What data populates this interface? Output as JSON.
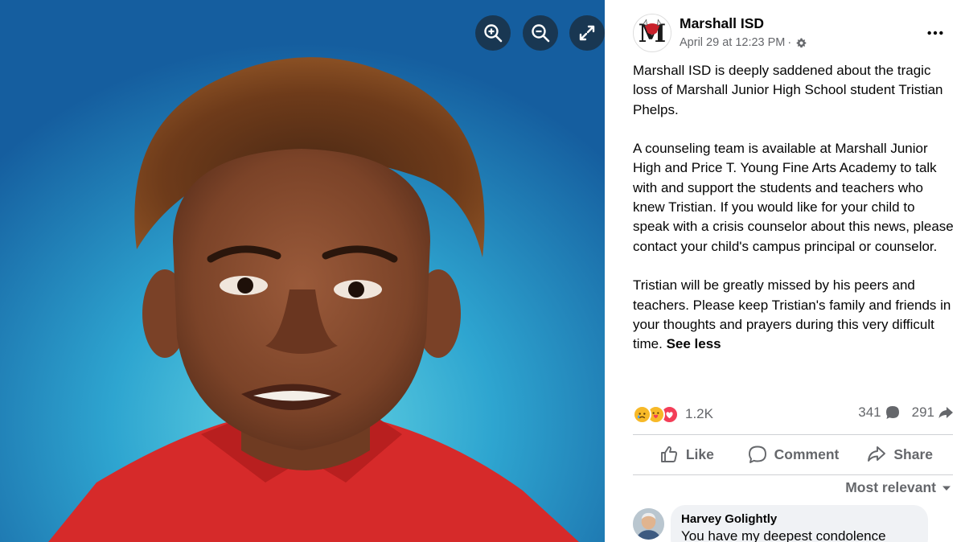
{
  "viewer": {
    "zoom_in_icon": "zoom-in-icon",
    "zoom_out_icon": "zoom-out-icon",
    "fullscreen_icon": "expand-icon"
  },
  "post": {
    "page_name": "Marshall ISD",
    "timestamp": "April 29 at 12:23 PM",
    "meta_separator": "·",
    "privacy_icon": "gear-icon",
    "paragraphs": [
      "Marshall ISD is deeply saddened about the tragic loss of Marshall Junior High School student Tristian Phelps.",
      "A counseling team is available at Marshall Junior High and Price T. Young Fine Arts Academy to talk with and support the students and teachers who knew Tristian. If you would like for your child to speak with a crisis counselor about this news, please contact your child's campus principal or counselor.",
      "Tristian will be greatly missed by his peers and teachers. Please keep Tristian's family and friends in your thoughts and prayers during this very difficult time."
    ],
    "see_less": "See less",
    "reactions": {
      "types": [
        "sad",
        "care",
        "love"
      ],
      "count": "1.2K"
    },
    "comment_count": "341",
    "share_count": "291"
  },
  "actions": {
    "like": "Like",
    "comment": "Comment",
    "share": "Share"
  },
  "comments": {
    "sort_label": "Most relevant",
    "items": [
      {
        "author": "Harvey Golightly",
        "text": "You have my deepest condolence"
      }
    ]
  },
  "colors": {
    "fb_text": "#050505",
    "fb_secondary": "#65676b",
    "photo_bg": "#2aa3cf",
    "shirt": "#d62a2a",
    "love": "#f33e58",
    "sad_care": "#f7b928"
  }
}
